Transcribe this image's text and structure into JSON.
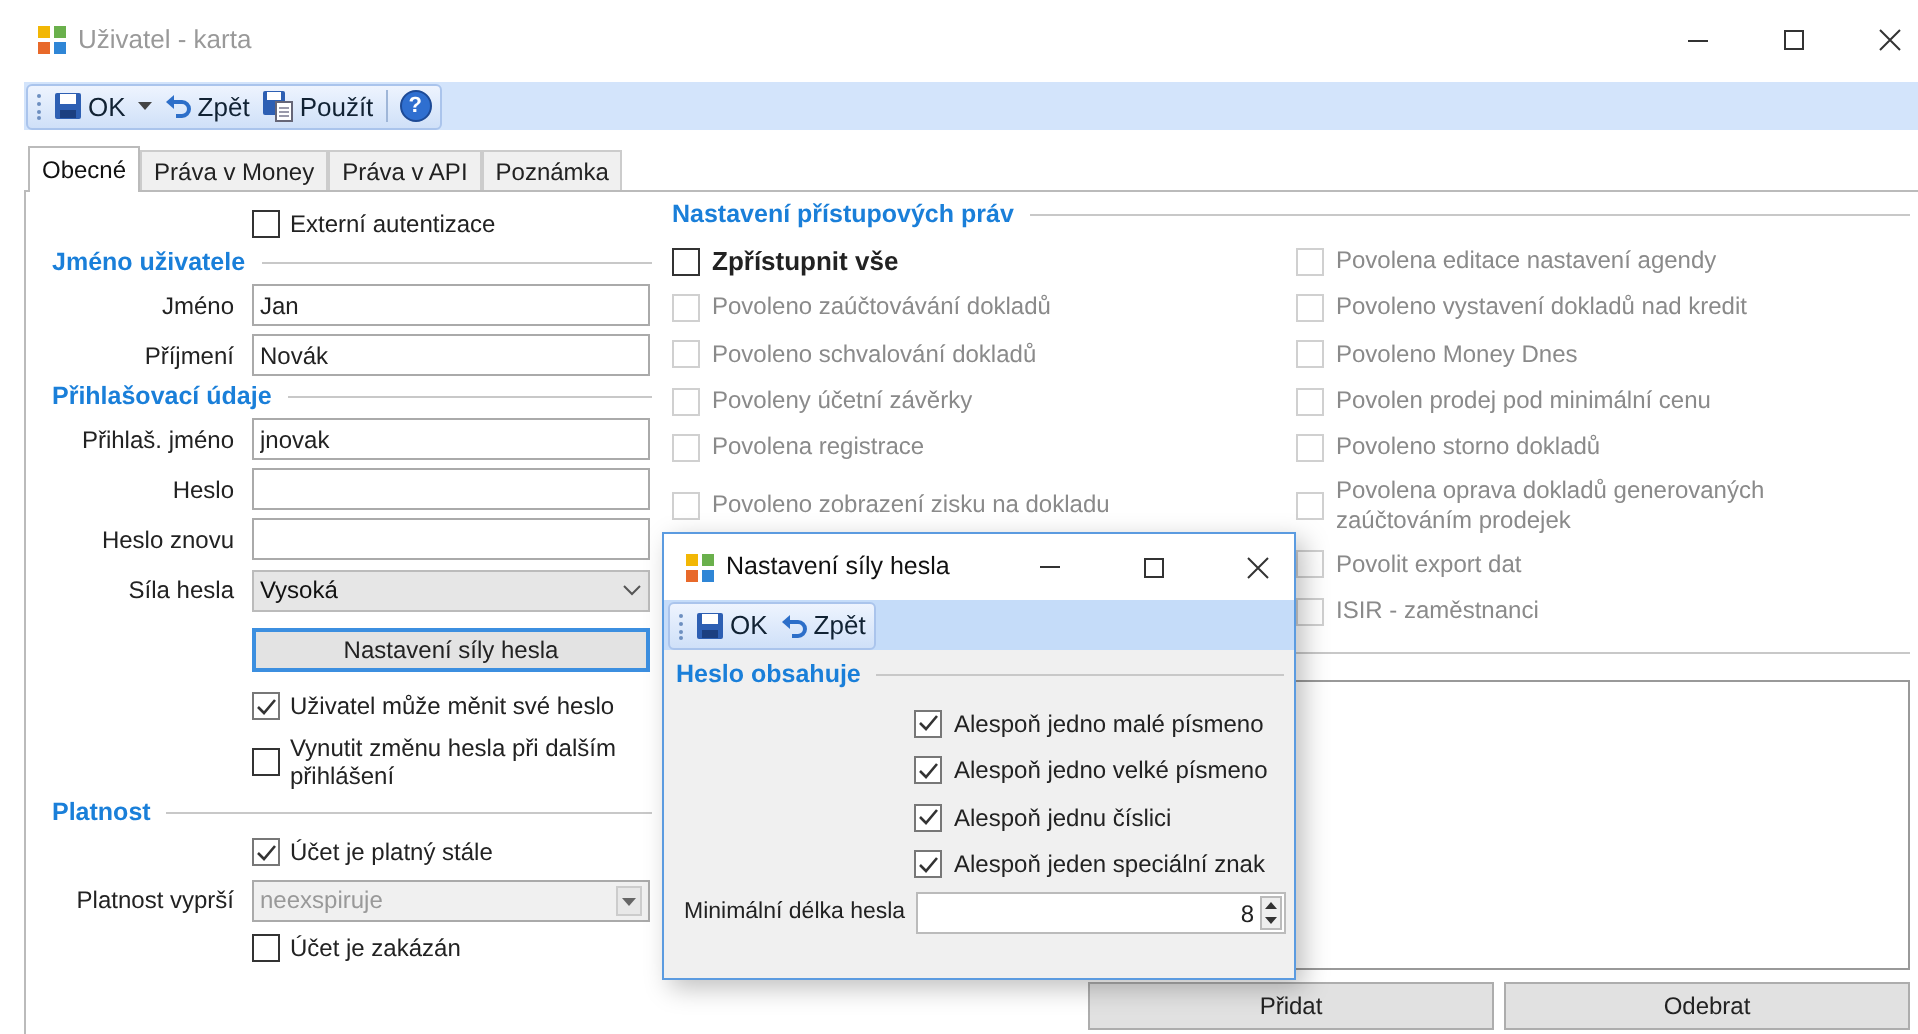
{
  "window": {
    "title": "Uživatel - karta"
  },
  "toolbar": [
    {
      "kind": "save",
      "label": "OK",
      "dropdown": true
    },
    {
      "kind": "undo",
      "label": "Zpět"
    },
    {
      "kind": "apply",
      "label": "Použít"
    },
    {
      "kind": "help",
      "label": "?"
    }
  ],
  "tabs": [
    {
      "label": "Obecné",
      "selected": true
    },
    {
      "label": "Práva v Money",
      "selected": false
    },
    {
      "label": "Práva v API",
      "selected": false
    },
    {
      "label": "Poznámka",
      "selected": false
    }
  ],
  "form": [
    {
      "kind": "checkbox",
      "label": "Externí autentizace",
      "checked": false
    },
    {
      "kind": "header",
      "label": "Jméno uživatele"
    },
    {
      "kind": "field",
      "label": "Jméno",
      "value": "Jan"
    },
    {
      "kind": "field",
      "label": "Příjmení",
      "value": "Novák"
    },
    {
      "kind": "header",
      "label": "Přihlašovací údaje"
    },
    {
      "kind": "field",
      "label": "Přihlaš. jméno",
      "value": "jnovak"
    },
    {
      "kind": "field",
      "label": "Heslo"
    },
    {
      "kind": "field",
      "label": "Heslo znovu"
    },
    {
      "kind": "dropdown",
      "label": "Síla hesla",
      "value": "Vysoká",
      "disabled": false
    },
    {
      "kind": "button",
      "label": "Nastavení síly hesla"
    },
    {
      "kind": "checkbox",
      "label": "Uživatel může měnit své heslo",
      "checked": true
    },
    {
      "kind": "checkbox",
      "label": "Vynutit změnu hesla při dalším přihlášení",
      "checked": false
    },
    {
      "kind": "header",
      "label": "Platnost"
    },
    {
      "kind": "checkbox",
      "label": "Účet je platný stále",
      "checked": true
    },
    {
      "kind": "dropdown",
      "label": "Platnost vyprší",
      "value": "neexspiruje",
      "disabled": true
    },
    {
      "kind": "checkbox",
      "label": "Účet je zakázán",
      "checked": false
    }
  ],
  "permissions": {
    "title": "Nastavení přístupových práv",
    "columns": [
      [
        {
          "label": "Zpřístupnit vše",
          "checked": false,
          "disabled": false,
          "bold": true
        },
        {
          "label": "Povoleno zaúčtovávání dokladů",
          "checked": false,
          "disabled": true
        },
        {
          "label": "Povoleno schvalování dokladů",
          "checked": false,
          "disabled": true
        },
        {
          "label": "Povoleny účetní závěrky",
          "checked": false,
          "disabled": true
        },
        {
          "label": "Povolena registrace",
          "checked": false,
          "disabled": true
        },
        {
          "label": "Povoleno zobrazení zisku na dokladu",
          "checked": false,
          "disabled": true
        }
      ],
      [
        {
          "label": "Povolena editace nastavení agendy",
          "checked": false,
          "disabled": true
        },
        {
          "label": "Povoleno vystavení dokladů nad kredit",
          "checked": false,
          "disabled": true
        },
        {
          "label": "Povoleno Money Dnes",
          "checked": false,
          "disabled": true
        },
        {
          "label": "Povolen prodej pod minimální cenu",
          "checked": false,
          "disabled": true
        },
        {
          "label": "Povoleno storno dokladů",
          "checked": false,
          "disabled": true
        },
        {
          "label": "Povolena oprava dokladů generovaných zaúčtováním prodejek",
          "checked": false,
          "disabled": true
        },
        {
          "label": "Povolit export dat",
          "checked": false,
          "disabled": true
        },
        {
          "label": "ISIR - zaměstnanci",
          "checked": false,
          "disabled": true
        }
      ]
    ]
  },
  "buttons": [
    "Přidat",
    "Odebrat"
  ],
  "dialog": {
    "title": "Nastavení síly hesla",
    "toolbar": [
      {
        "kind": "save",
        "label": "OK"
      },
      {
        "kind": "undo",
        "label": "Zpět"
      }
    ],
    "section": "Heslo obsahuje",
    "options": [
      {
        "label": "Alespoň jedno malé písmeno",
        "checked": true
      },
      {
        "label": "Alespoň jedno velké písmeno",
        "checked": true
      },
      {
        "label": "Alespoň jednu číslici",
        "checked": true
      },
      {
        "label": "Alespoň jeden speciální znak",
        "checked": true
      }
    ],
    "min_length": {
      "label": "Minimální délka hesla",
      "value": "8"
    }
  }
}
